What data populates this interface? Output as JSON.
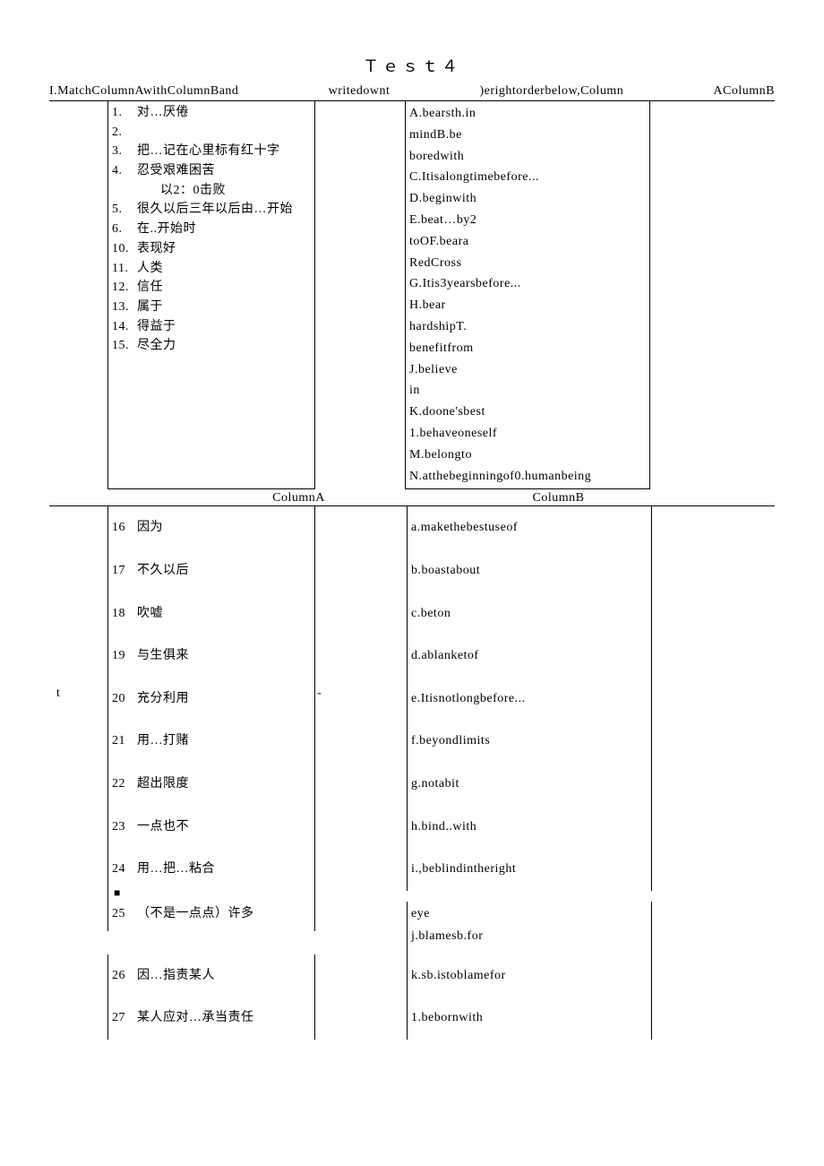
{
  "title": "Ｔｅｓｔ４",
  "instruction": {
    "s1": "I.MatchColumnAwithColumnBand",
    "s2": "writedownt",
    "s3": ")erightorderbelow,Column",
    "s4": "AColumnB"
  },
  "section1": {
    "colA": [
      {
        "n": "1.",
        "t": "对…厌倦"
      },
      {
        "n": "2.",
        "t": ""
      },
      {
        "n": "3.",
        "t": "把…记在心里标有红十字"
      },
      {
        "n": "4.",
        "t": "忍受艰难困苦"
      },
      {
        "n": "",
        "t": " "
      },
      {
        "n": "",
        "t": "以2：0击败",
        "indent": true
      },
      {
        "n": "5.",
        "t": "很久以后三年以后由…开始"
      },
      {
        "n": "6.",
        "t": "在..开始时"
      },
      {
        "n": "10.",
        "t": "表现好"
      },
      {
        "n": "11.",
        "t": "人类"
      },
      {
        "n": "12.",
        "t": "信任"
      },
      {
        "n": "13.",
        "t": "属于"
      },
      {
        "n": "14.",
        "t": "得益于"
      },
      {
        "n": "15.",
        "t": "尽全力"
      }
    ],
    "colB": [
      "A.bearsth.in",
      "mindB.be",
      "boredwith",
      "C.Itisalongtimebefore...",
      "D.beginwith",
      "E.beat…by2",
      "toOF.beara",
      " ",
      "RedCross",
      "G.Itis3yearsbefore...",
      "H.bear",
      "hardshipT.",
      "benefitfrom",
      "J.believe",
      "in",
      "K.doone'sbest",
      "1.behaveoneself",
      "M.belongto",
      "N.atthebeginningof0.humanbeing"
    ]
  },
  "section2Header": {
    "a": "ColumnA",
    "b": "ColumnB"
  },
  "section2": {
    "rows": [
      {
        "pre": "",
        "n": "16",
        "a": "因为",
        "mid": "",
        "b": "a.makethebestuseof"
      },
      {
        "pre": "",
        "n": "17",
        "a": "不久以后",
        "mid": "",
        "b": "b.boastabout"
      },
      {
        "pre": "",
        "n": "18",
        "a": "吹嘘",
        "mid": "",
        "b": "c.beton"
      },
      {
        "pre": "",
        "n": "19",
        "a": "与生俱来",
        "mid": "",
        "b": "d.ablanketof"
      },
      {
        "pre": "t",
        "n": "20",
        "a": "充分利用",
        "mid": "-",
        "b": "e.Itisnotlongbefore..."
      },
      {
        "pre": "",
        "n": "21",
        "a": "用…打赌",
        "mid": "",
        "b": "f.beyondlimits"
      },
      {
        "pre": "",
        "n": "22",
        "a": "超出限度",
        "mid": "",
        "b": "g.notabit"
      },
      {
        "pre": "",
        "n": "23",
        "a": "一点也不",
        "mid": "",
        "b": "h.bind..with"
      },
      {
        "pre": "",
        "n": "24",
        "a": "用…把…粘合",
        "mid": "",
        "b": "i.,beblindintheright",
        "square": true
      },
      {
        "pre": "",
        "n": "25",
        "a": "（不是一点点）许多",
        "mid": "",
        "b": "eye",
        "tight": true,
        "b2": "j.blamesb.for"
      },
      {
        "pre": "",
        "n": "26",
        "a": "因…指责某人",
        "mid": "",
        "b": "k.sb.istoblamefor"
      },
      {
        "pre": "",
        "n": "27",
        "a": "某人应对…承当责任",
        "mid": "",
        "b": "1.bebornwith"
      }
    ]
  }
}
